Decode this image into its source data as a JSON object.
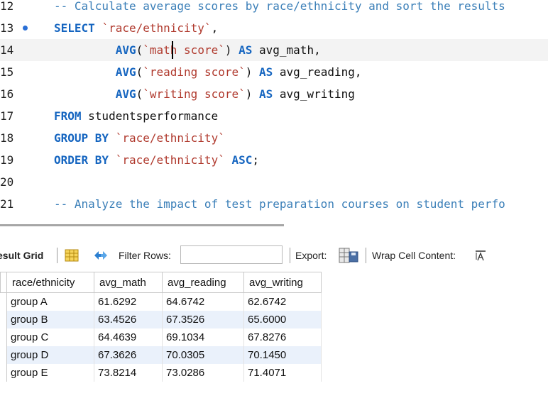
{
  "editor": {
    "lines": [
      {
        "num": "12",
        "tokens": [
          {
            "c": "cm",
            "t": "-- Calculate average scores by race/ethnicity and sort the results"
          }
        ]
      },
      {
        "num": "13",
        "marker": true,
        "tokens": [
          {
            "c": "kw",
            "t": "SELECT"
          },
          {
            "c": "id",
            "t": " "
          },
          {
            "c": "str",
            "t": "`race/ethnicity`"
          },
          {
            "c": "id",
            "t": ","
          }
        ]
      },
      {
        "num": "14",
        "current": true,
        "tokens": [
          {
            "c": "id",
            "t": "         "
          },
          {
            "c": "kw",
            "t": "AVG"
          },
          {
            "c": "id",
            "t": "("
          },
          {
            "c": "str",
            "t": "`math score`"
          },
          {
            "c": "id",
            "t": ") "
          },
          {
            "c": "kw",
            "t": "AS"
          },
          {
            "c": "id",
            "t": " avg_math,"
          }
        ]
      },
      {
        "num": "15",
        "tokens": [
          {
            "c": "id",
            "t": "         "
          },
          {
            "c": "kw",
            "t": "AVG"
          },
          {
            "c": "id",
            "t": "("
          },
          {
            "c": "str",
            "t": "`reading score`"
          },
          {
            "c": "id",
            "t": ") "
          },
          {
            "c": "kw",
            "t": "AS"
          },
          {
            "c": "id",
            "t": " avg_reading,"
          }
        ]
      },
      {
        "num": "16",
        "tokens": [
          {
            "c": "id",
            "t": "         "
          },
          {
            "c": "kw",
            "t": "AVG"
          },
          {
            "c": "id",
            "t": "("
          },
          {
            "c": "str",
            "t": "`writing score`"
          },
          {
            "c": "id",
            "t": ") "
          },
          {
            "c": "kw",
            "t": "AS"
          },
          {
            "c": "id",
            "t": " avg_writing"
          }
        ]
      },
      {
        "num": "17",
        "tokens": [
          {
            "c": "kw",
            "t": "FROM"
          },
          {
            "c": "id",
            "t": " studentsperformance"
          }
        ]
      },
      {
        "num": "18",
        "tokens": [
          {
            "c": "kw",
            "t": "GROUP BY"
          },
          {
            "c": "id",
            "t": " "
          },
          {
            "c": "str",
            "t": "`race/ethnicity`"
          }
        ]
      },
      {
        "num": "19",
        "tokens": [
          {
            "c": "kw",
            "t": "ORDER BY"
          },
          {
            "c": "id",
            "t": " "
          },
          {
            "c": "str",
            "t": "`race/ethnicity`"
          },
          {
            "c": "id",
            "t": " "
          },
          {
            "c": "kw",
            "t": "ASC"
          },
          {
            "c": "id",
            "t": ";"
          }
        ]
      },
      {
        "num": "20",
        "tokens": []
      },
      {
        "num": "21",
        "tokens": [
          {
            "c": "cm",
            "t": "-- Analyze the impact of test preparation courses on student perfo"
          }
        ]
      }
    ]
  },
  "toolbar": {
    "result_grid_label": "esult Grid",
    "filter_rows_label": "Filter Rows:",
    "filter_value": "",
    "export_label": "Export:",
    "wrap_label": "Wrap Cell Content:"
  },
  "results": {
    "columns": [
      "race/ethnicity",
      "avg_math",
      "avg_reading",
      "avg_writing"
    ],
    "rows": [
      [
        "group A",
        "61.6292",
        "64.6742",
        "62.6742"
      ],
      [
        "group B",
        "63.4526",
        "67.3526",
        "65.6000"
      ],
      [
        "group C",
        "64.4639",
        "69.1034",
        "67.8276"
      ],
      [
        "group D",
        "67.3626",
        "70.0305",
        "70.1450"
      ],
      [
        "group E",
        "73.8214",
        "73.0286",
        "71.4071"
      ]
    ]
  },
  "colors": {
    "keyword": "#1565c0",
    "string": "#b03a2e",
    "comment": "#3b7fb8",
    "alt_row": "#eaf1fb",
    "marker": "#2a6fd6"
  }
}
